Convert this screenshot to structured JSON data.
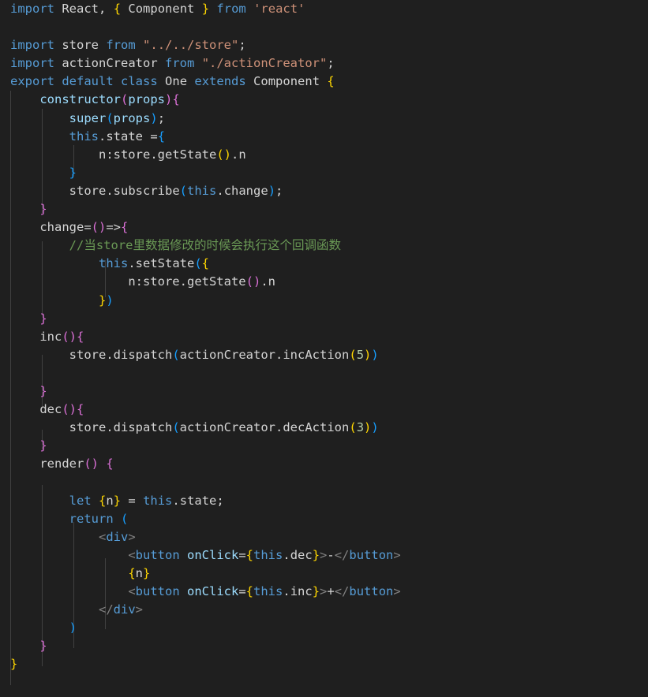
{
  "editor": {
    "app": "code-editor",
    "language": "javascript-react-jsx",
    "theme": "dark-plus",
    "background_color": "#1f1f1f",
    "default_text_color": "#d4d4d4",
    "font_size_px": 15.5,
    "line_height_px": 23.1,
    "indent_guide_color": "#404040",
    "syntax_colors": {
      "keyword": "#569cd6",
      "string": "#ce9178",
      "comment": "#6a9955",
      "function": "#dcdcaa",
      "property": "#9cdcfe",
      "number": "#b5cea8",
      "jsx_bracket": "#808080",
      "jsx_tag": "#569cd6",
      "bracket_level_1": "#ffd700",
      "bracket_level_2": "#da70d6",
      "bracket_level_3": "#179fff"
    }
  },
  "code": {
    "filename_hint": "One",
    "lines": [
      "import React, { Component } from 'react'",
      "",
      "import store from \"../../store\";",
      "import actionCreator from \"./actionCreator\";",
      "export default class One extends Component {",
      "    constructor(props){",
      "        super(props);",
      "        this.state ={",
      "            n:store.getState().n",
      "        }",
      "        store.subscribe(this.change);",
      "    }",
      "    change=()=>{",
      "        //当store里数据修改的时候会执行这个回调函数",
      "            this.setState({",
      "                n:store.getState().n",
      "            })",
      "    }",
      "    inc(){",
      "        store.dispatch(actionCreator.incAction(5))",
      "",
      "    }",
      "    dec(){",
      "        store.dispatch(actionCreator.decAction(3))",
      "    }",
      "    render() {",
      "",
      "        let {n} = this.state;",
      "        return (",
      "            <div>",
      "                <button onClick={this.dec}>-</button>",
      "                {n}",
      "                <button onClick={this.inc}>+</button>",
      "            </div>",
      "        )",
      "    }",
      "}"
    ],
    "comment_text": "//当store里数据修改的时候会执行这个回调函数",
    "imports": [
      {
        "names": "React, { Component }",
        "source": "react"
      },
      {
        "names": "store",
        "source": "../../store"
      },
      {
        "names": "actionCreator",
        "source": "./actionCreator"
      }
    ],
    "class_declaration": {
      "name": "One",
      "extends": "Component",
      "export": "export default"
    },
    "methods": [
      "constructor",
      "change",
      "inc",
      "dec",
      "render"
    ],
    "numbers": {
      "inc_amount": "5",
      "dec_amount": "3"
    },
    "jsx_elements": [
      "div",
      "button",
      "button"
    ],
    "button_labels": [
      "-",
      "+"
    ],
    "state_expression": "n:store.getState().n"
  }
}
